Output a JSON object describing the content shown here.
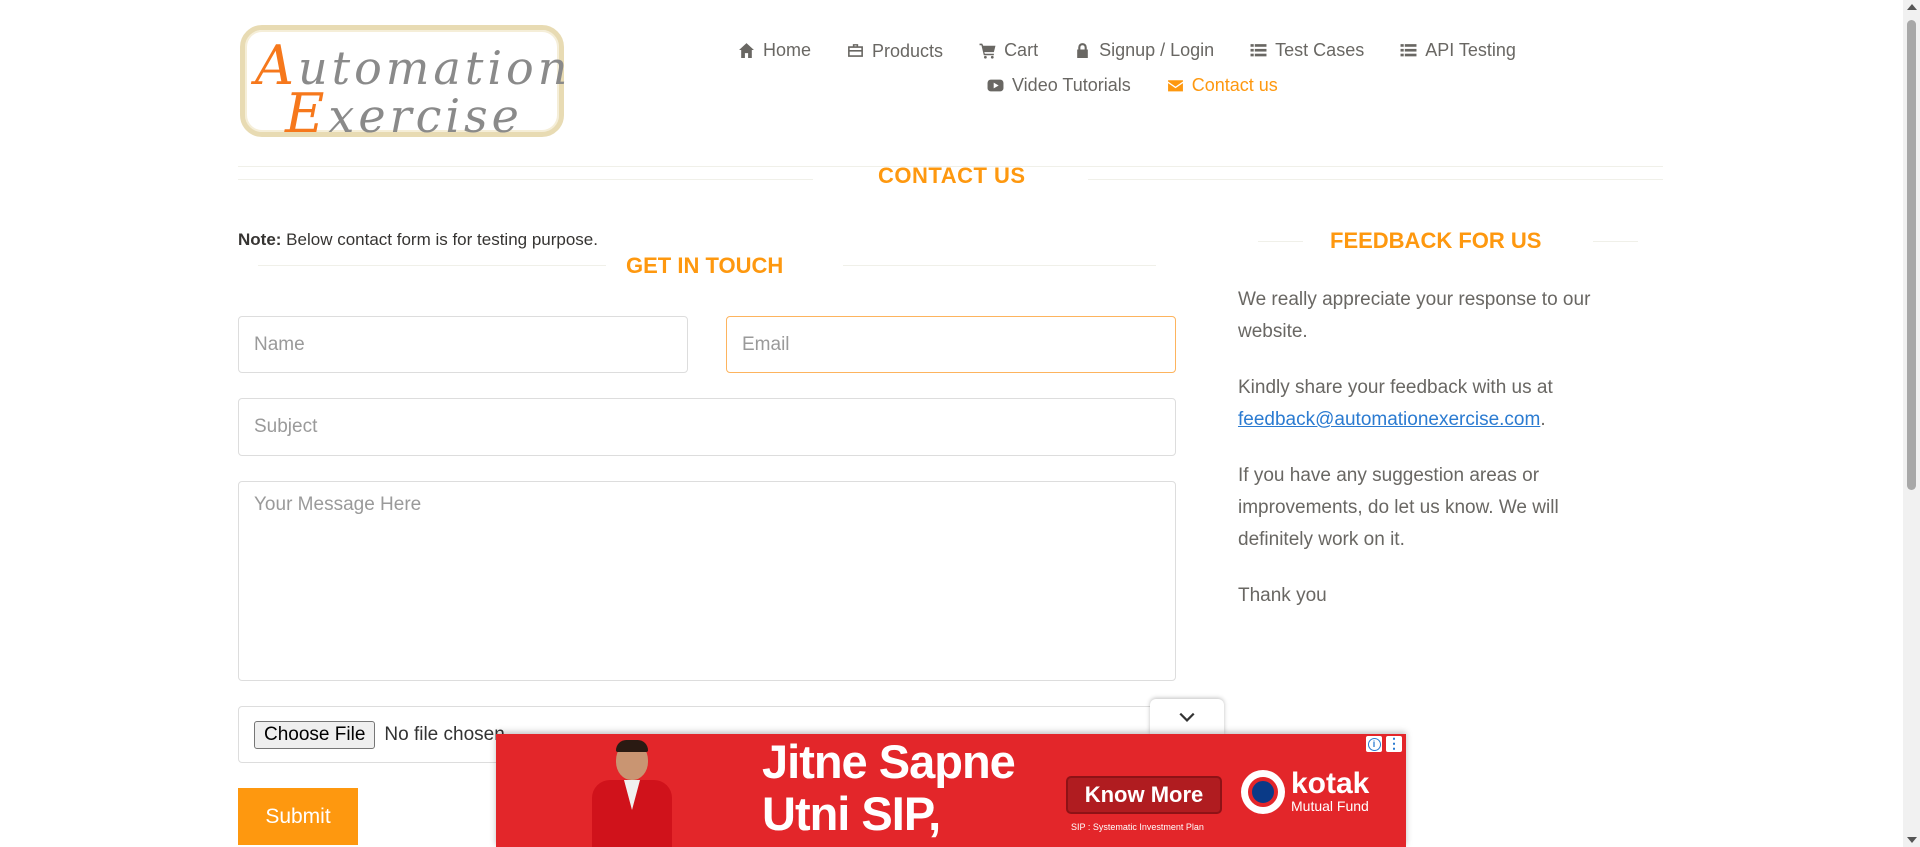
{
  "logo": {
    "line1_first": "A",
    "line1_rest": "utomation",
    "line2_first": "E",
    "line2_rest": "xercise"
  },
  "nav": {
    "items": [
      {
        "label": "Home",
        "icon": "home-icon"
      },
      {
        "label": "Products",
        "icon": "briefcase-icon"
      },
      {
        "label": "Cart",
        "icon": "cart-icon"
      },
      {
        "label": "Signup / Login",
        "icon": "lock-icon"
      },
      {
        "label": "Test Cases",
        "icon": "list-icon"
      },
      {
        "label": "API Testing",
        "icon": "list-icon"
      },
      {
        "label": "Video Tutorials",
        "icon": "youtube-icon"
      },
      {
        "label": "Contact us",
        "icon": "envelope-icon",
        "active": true
      }
    ]
  },
  "page": {
    "title": "CONTACT US",
    "note_bold": "Note:",
    "note_text": " Below contact form is for testing purpose."
  },
  "form": {
    "heading": "GET IN TOUCH",
    "name_placeholder": "Name",
    "email_placeholder": "Email",
    "subject_placeholder": "Subject",
    "message_placeholder": "Your Message Here",
    "file_button": "Choose File",
    "file_status": "No file chosen",
    "submit_label": "Submit"
  },
  "feedback": {
    "heading": "FEEDBACK FOR US",
    "p1": "We really appreciate your response to our website.",
    "p2_text": "Kindly share your feedback with us at ",
    "p2_email": "feedback@automationexercise.com",
    "p2_end": ".",
    "p3": "If you have any suggestion areas or improvements, do let us know. We will definitely work on it.",
    "p4": "Thank you"
  },
  "ad": {
    "headline_line1": "Jitne Sapne",
    "headline_line2": "Utni SIP,",
    "cta": "Know More",
    "subtext": "SIP : Systematic Investment Plan",
    "brand": "kotak",
    "brand_sub": "Mutual Fund"
  },
  "colors": {
    "accent": "#fe980f",
    "text": "#696763",
    "link": "#2b7bd1",
    "ad_red": "#e3262a"
  }
}
